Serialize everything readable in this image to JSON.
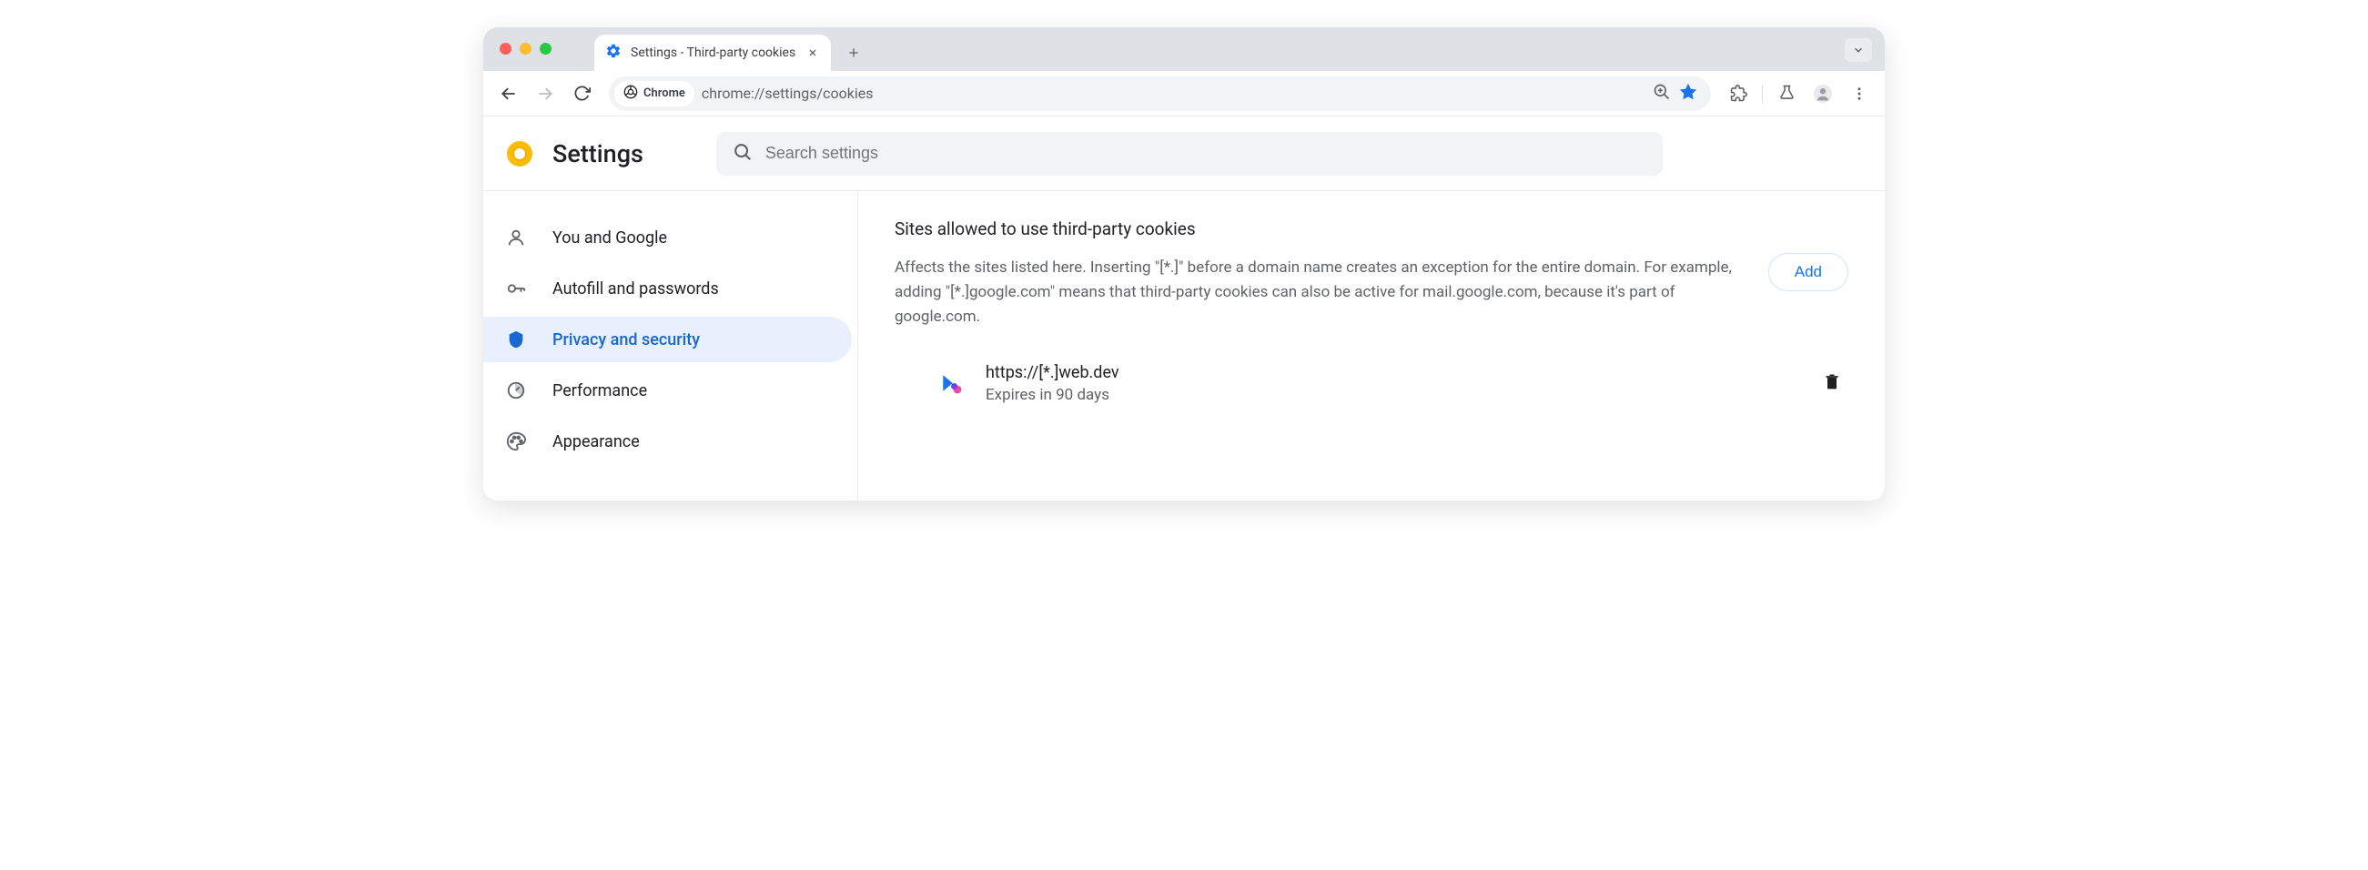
{
  "tab": {
    "title": "Settings - Third-party cookies"
  },
  "omnibox": {
    "chip": "Chrome",
    "url": "chrome://settings/cookies"
  },
  "header": {
    "title": "Settings",
    "search_placeholder": "Search settings"
  },
  "sidebar": {
    "items": [
      {
        "label": "You and Google",
        "icon": "person"
      },
      {
        "label": "Autofill and passwords",
        "icon": "key"
      },
      {
        "label": "Privacy and security",
        "icon": "shield",
        "active": true
      },
      {
        "label": "Performance",
        "icon": "speedometer"
      },
      {
        "label": "Appearance",
        "icon": "palette"
      }
    ]
  },
  "main": {
    "section_title": "Sites allowed to use third-party cookies",
    "section_desc": "Affects the sites listed here. Inserting \"[*.]\" before a domain name creates an exception for the entire domain. For example, adding \"[*.]google.com\" means that third-party cookies can also be active for mail.google.com, because it's part of google.com.",
    "add_label": "Add",
    "sites": [
      {
        "url": "https://[*.]web.dev",
        "expiry": "Expires in 90 days"
      }
    ]
  }
}
